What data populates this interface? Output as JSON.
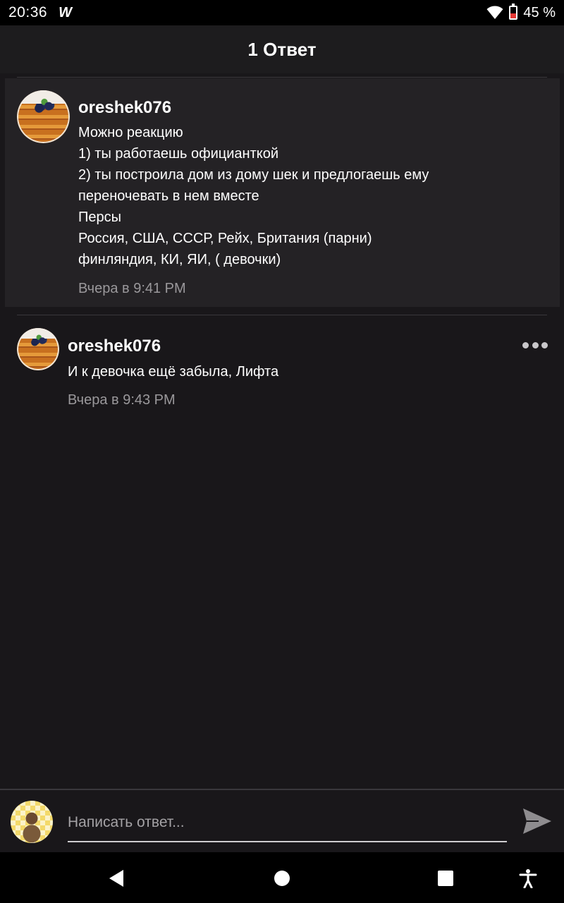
{
  "status_bar": {
    "time": "20:36",
    "app_icon": "W",
    "battery_percent": "45 %",
    "battery_level": 0.45,
    "icons": [
      "wifi-icon",
      "battery-icon"
    ]
  },
  "header": {
    "title": "1 Ответ"
  },
  "comments": [
    {
      "username": "oreshek076",
      "lines": [
        "Можно реакцию",
        "1) ты работаешь официанткой",
        "2) ты построила дом из дому шек и предлогаешь ему",
        "переночевать в нем вместе",
        "Персы",
        "Россия, США, СССР, Рейх, Британия (парни)",
        "финляндия, КИ, ЯИ, ( девочки)"
      ],
      "timestamp": "Вчера в 9:41 PM"
    },
    {
      "username": "oreshek076",
      "lines": [
        "И к девочка ещё забыла, Лифта"
      ],
      "timestamp": "Вчера в 9:43 PM"
    }
  ],
  "reply": {
    "placeholder": "Написать ответ..."
  },
  "nav": {
    "icons": [
      "back-icon",
      "home-icon",
      "recents-icon",
      "accessibility-icon"
    ]
  }
}
